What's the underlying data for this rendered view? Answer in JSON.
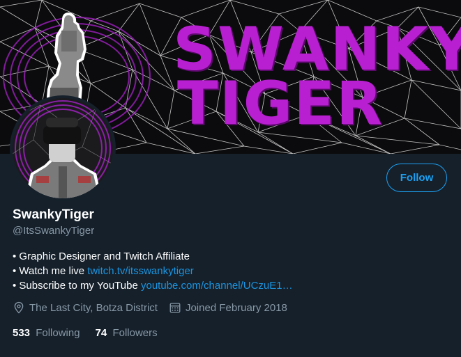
{
  "banner": {
    "title_line1": "SWANKY",
    "title_line2": "TIGER",
    "accent_color": "#b81fd1"
  },
  "profile": {
    "display_name": "SwankyTiger",
    "handle": "@ItsSwankyTiger",
    "follow_label": "Follow",
    "bio": [
      {
        "text": "• Graphic Designer and Twitch Affiliate",
        "link": ""
      },
      {
        "text": "• Watch me live ",
        "link": "twitch.tv/itsswankytiger"
      },
      {
        "text": "• Subscribe to my YouTube ",
        "link": "youtube.com/channel/UCzuE1…"
      }
    ],
    "location": "The Last City, Botza District",
    "joined": "Joined February 2018",
    "following_count": "533",
    "following_label": "Following",
    "followers_count": "74",
    "followers_label": "Followers"
  },
  "icons": {
    "location": "location-pin-icon",
    "calendar": "calendar-icon"
  },
  "colors": {
    "background": "#15202b",
    "link": "#1b95e0",
    "follow_border": "#1da1f2",
    "muted": "#8899a6"
  }
}
